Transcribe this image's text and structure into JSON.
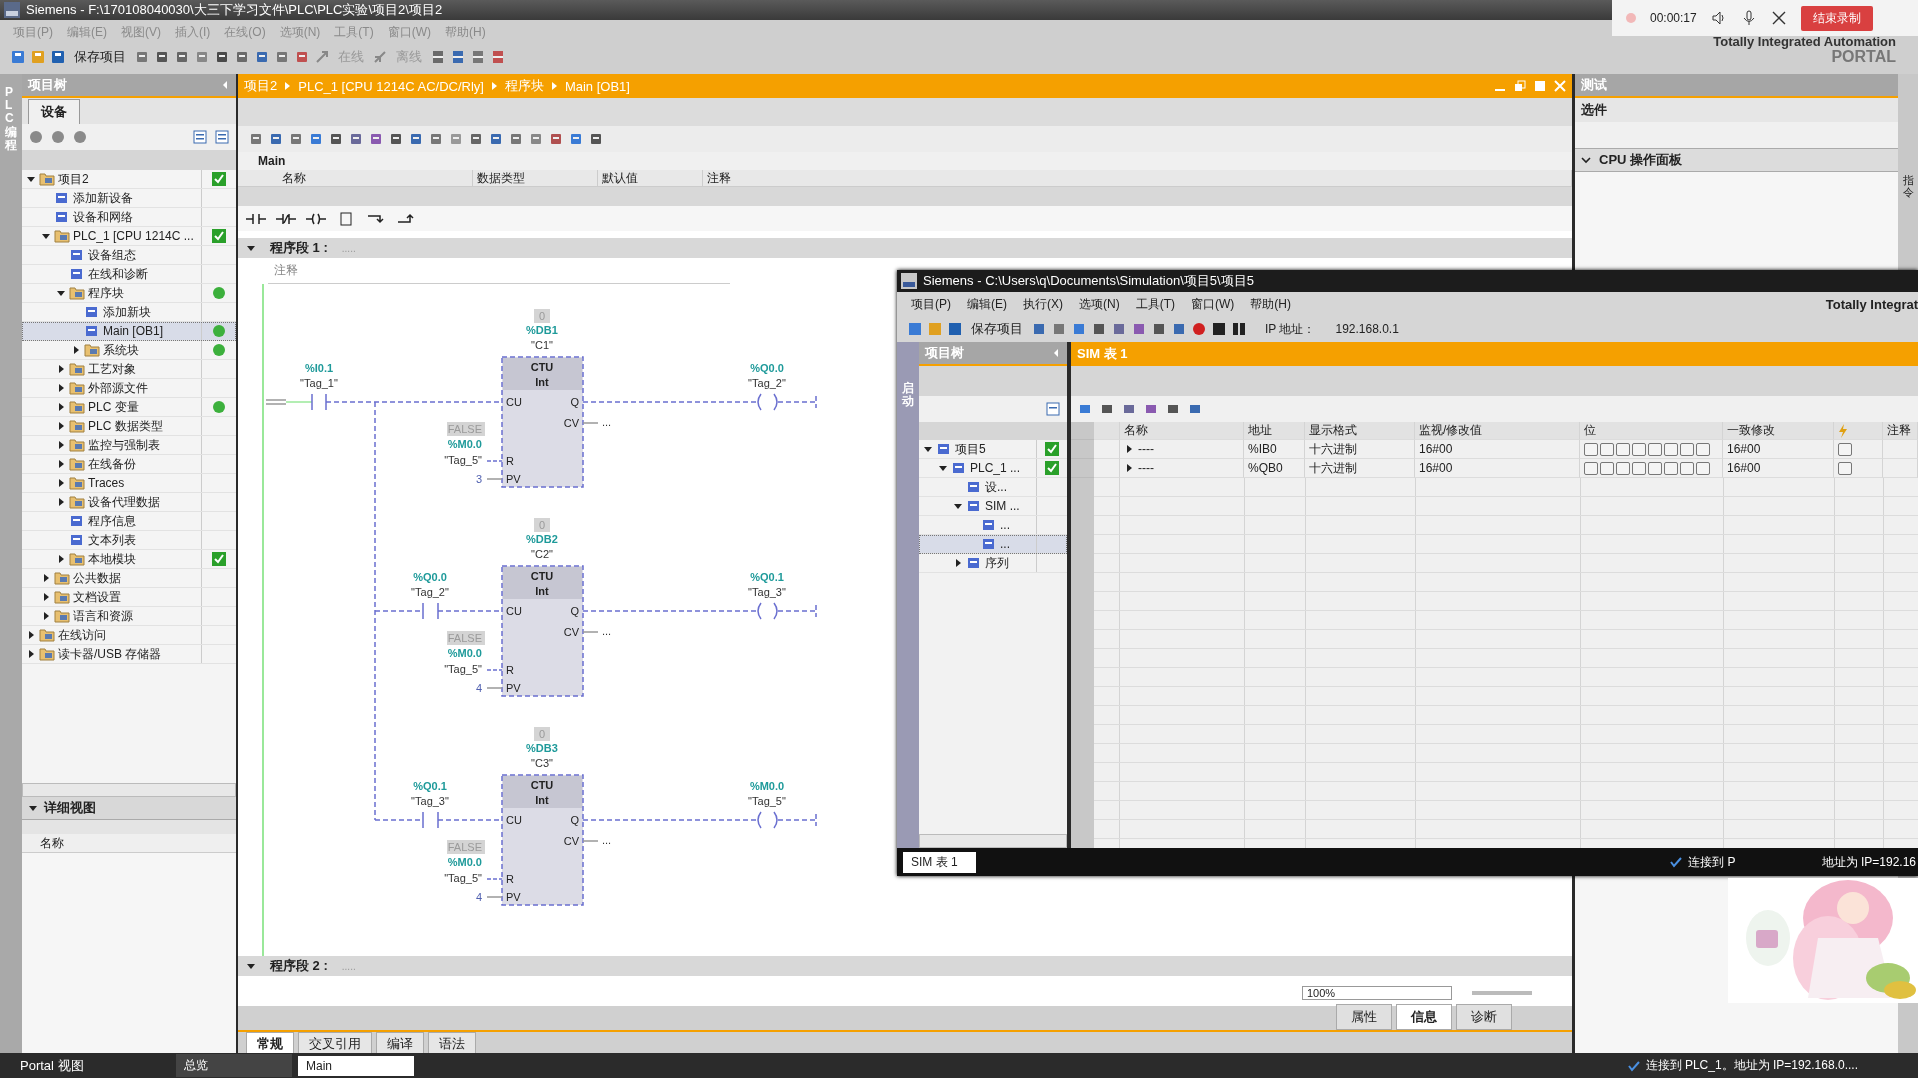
{
  "window": {
    "title": "Siemens  -  F:\\170108040030\\大三下学习文件\\PLC\\PLC实验\\项目2\\项目2"
  },
  "recorder": {
    "time": "00:00:17",
    "stop_button": "结束录制"
  },
  "menu": [
    "项目(P)",
    "编辑(E)",
    "视图(V)",
    "插入(I)",
    "在线(O)",
    "选项(N)",
    "工具(T)",
    "窗口(W)",
    "帮助(H)"
  ],
  "toolbar": [
    {
      "label": "保存项目",
      "disabled": false
    },
    {
      "label": "在线",
      "disabled": true
    },
    {
      "label": "离线",
      "disabled": true
    }
  ],
  "brand": {
    "line1": "Totally Integrated Automation",
    "line2": "PORTAL"
  },
  "left_strip": "PLC 编程",
  "project_tree": {
    "title": "项目树",
    "tab": "设备",
    "items": [
      {
        "label": "项目2",
        "expanded": true,
        "consistent": true,
        "selected": false,
        "children": [
          {
            "label": "添加新设备",
            "selected": false
          },
          {
            "label": "设备和网络",
            "selected": false
          },
          {
            "label": "PLC_1 [CPU 1214C ...",
            "expanded": true,
            "consistent": true,
            "selected": false,
            "children": [
              {
                "label": "设备组态",
                "selected": false
              },
              {
                "label": "在线和诊断",
                "selected": false
              },
              {
                "label": "程序块",
                "expanded": true,
                "online": true,
                "selected": false,
                "children": [
                  {
                    "label": "添加新块",
                    "selected": false
                  },
                  {
                    "label": "Main [OB1]",
                    "online": true,
                    "selected": true
                  },
                  {
                    "label": "系统块",
                    "expanded": false,
                    "online": true,
                    "selected": false
                  }
                ]
              },
              {
                "label": "工艺对象",
                "expanded": false,
                "selected": false
              },
              {
                "label": "外部源文件",
                "expanded": false,
                "selected": false
              },
              {
                "label": "PLC 变量",
                "expanded": false,
                "online": true,
                "selected": false
              },
              {
                "label": "PLC 数据类型",
                "expanded": false,
                "selected": false
              },
              {
                "label": "监控与强制表",
                "expanded": false,
                "selected": false
              },
              {
                "label": "在线备份",
                "expanded": false,
                "selected": false
              },
              {
                "label": "Traces",
                "expanded": false,
                "selected": false
              },
              {
                "label": "设备代理数据",
                "expanded": false,
                "selected": false
              },
              {
                "label": "程序信息",
                "selected": false
              },
              {
                "label": "文本列表",
                "selected": false
              },
              {
                "label": "本地模块",
                "expanded": false,
                "consistent": true,
                "selected": false
              }
            ]
          },
          {
            "label": "公共数据",
            "expanded": false,
            "selected": false
          },
          {
            "label": "文档设置",
            "expanded": false,
            "selected": false
          },
          {
            "label": "语言和资源",
            "expanded": false,
            "selected": false
          }
        ]
      },
      {
        "label": "在线访问",
        "expanded": false,
        "selected": false
      },
      {
        "label": "读卡器/USB 存储器",
        "expanded": false,
        "selected": false
      }
    ]
  },
  "detail_view": {
    "title": "详细视图",
    "column": "名称"
  },
  "editor": {
    "breadcrumb": [
      "项目2",
      "PLC_1 [CPU 1214C AC/DC/Rly]",
      "程序块",
      "Main [OB1]"
    ],
    "block_name": "Main",
    "interface_columns": [
      "名称",
      "数据类型",
      "默认值",
      "注释"
    ],
    "networks": [
      {
        "title": "程序段 1 :",
        "dots": ".....",
        "comment": "注释"
      },
      {
        "title": "程序段 2 :",
        "dots": "....."
      }
    ],
    "rungs": [
      {
        "counter_value": "0",
        "db": "%DB1",
        "instance": "\"C1\"",
        "type": "CTU",
        "datatype": "Int",
        "contact": {
          "address": "%I0.1",
          "tag": "\"Tag_1\""
        },
        "pins": [
          "CU",
          "Q",
          "CV",
          "R",
          "PV"
        ],
        "cv": "...",
        "reset": {
          "value": "FALSE",
          "address": "%M0.0",
          "tag": "\"Tag_5\""
        },
        "pv": "3",
        "coil": {
          "address": "%Q0.0",
          "tag": "\"Tag_2\""
        }
      },
      {
        "counter_value": "0",
        "db": "%DB2",
        "instance": "\"C2\"",
        "type": "CTU",
        "datatype": "Int",
        "contact": {
          "address": "%Q0.0",
          "tag": "\"Tag_2\""
        },
        "pins": [
          "CU",
          "Q",
          "CV",
          "R",
          "PV"
        ],
        "cv": "...",
        "reset": {
          "value": "FALSE",
          "address": "%M0.0",
          "tag": "\"Tag_5\""
        },
        "pv": "4",
        "coil": {
          "address": "%Q0.1",
          "tag": "\"Tag_3\""
        }
      },
      {
        "counter_value": "0",
        "db": "%DB3",
        "instance": "\"C3\"",
        "type": "CTU",
        "datatype": "Int",
        "contact": {
          "address": "%Q0.1",
          "tag": "\"Tag_3\""
        },
        "pins": [
          "CU",
          "Q",
          "CV",
          "R",
          "PV"
        ],
        "cv": "...",
        "reset": {
          "value": "FALSE",
          "address": "%M0.0",
          "tag": "\"Tag_5\""
        },
        "pv": "4",
        "coil": {
          "address": "%M0.0",
          "tag": "\"Tag_5\""
        }
      }
    ],
    "zoom": "100%"
  },
  "inspector": {
    "tabs": [
      {
        "label": "属性",
        "selected": false
      },
      {
        "label": "信息",
        "selected": true
      },
      {
        "label": "诊断",
        "selected": false
      }
    ],
    "subtabs": [
      {
        "label": "常规",
        "selected": true
      },
      {
        "label": "交叉引用",
        "selected": false
      },
      {
        "label": "编译",
        "selected": false
      },
      {
        "label": "语法",
        "selected": false
      }
    ]
  },
  "test_panel": {
    "title": "测试",
    "options": "选件",
    "section": {
      "label": "CPU 操作面板",
      "expanded": true
    }
  },
  "right_strip": "指令",
  "plcsim": {
    "title": "Siemens  -  C:\\Users\\q\\Documents\\Simulation\\项目5\\项目5",
    "menu": [
      "项目(P)",
      "编辑(E)",
      "执行(X)",
      "选项(N)",
      "工具(T)",
      "窗口(W)",
      "帮助(H)"
    ],
    "save_label": "保存项目",
    "ip_label": "IP 地址：",
    "ip": "192.168.0.1",
    "brand": "Totally Integrat",
    "left_strip": "启动",
    "tree_title": "项目树",
    "tree": [
      {
        "label": "项目5",
        "expanded": true,
        "consistent": true,
        "selected": false,
        "children": [
          {
            "label": "PLC_1 ...",
            "expanded": true,
            "consistent": true,
            "selected": false,
            "children": [
              {
                "label": "设...",
                "selected": false
              },
              {
                "label": "SIM ...",
                "expanded": true,
                "selected": false,
                "children": [
                  {
                    "label": "...",
                    "selected": false
                  },
                  {
                    "label": "...",
                    "selected": true
                  }
                ]
              },
              {
                "label": "序列",
                "expanded": false,
                "selected": false
              }
            ]
          }
        ]
      }
    ],
    "table_title": "SIM 表 1",
    "columns": [
      "名称",
      "地址",
      "显示格式",
      "监视/修改值",
      "位",
      "一致修改",
      "注释"
    ],
    "rows": [
      {
        "expanded": false,
        "name": "----",
        "address": "%IB0",
        "format": "十六进制",
        "value": "16#00",
        "bits": [
          false,
          false,
          false,
          false,
          false,
          false,
          false,
          false
        ],
        "consistent": "16#00",
        "trigger": false
      },
      {
        "expanded": false,
        "name": "----",
        "address": "%QB0",
        "format": "十六进制",
        "value": "16#00",
        "bits": [
          false,
          false,
          false,
          false,
          false,
          false,
          false,
          false
        ],
        "consistent": "16#00",
        "trigger": false
      }
    ],
    "tab": "SIM 表 1",
    "status_left": "连接到 P",
    "status_right": "地址为 IP=192.16"
  },
  "taskbar": {
    "portal_view": "Portal 视图",
    "tabs": [
      {
        "label": "总览",
        "selected": false
      },
      {
        "label": "Main",
        "selected": true
      }
    ],
    "status": "连接到 PLC_1。地址为 IP=192.168.0...."
  }
}
